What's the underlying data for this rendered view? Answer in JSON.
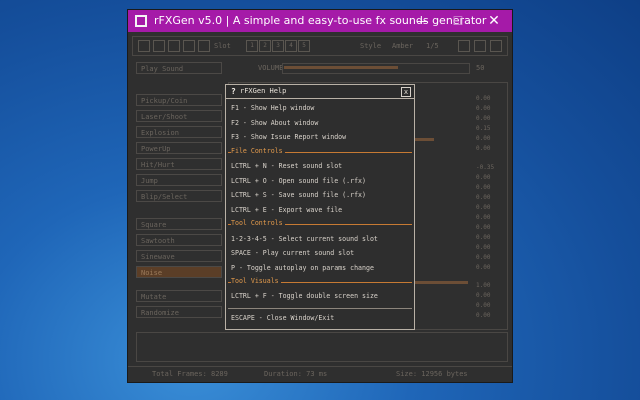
{
  "window": {
    "title": "rFXGen v5.0 | A simple and easy-to-use fx sounds generator",
    "min_glyph": "—",
    "max_glyph": "☐",
    "close_glyph": "✕"
  },
  "background_ui": {
    "toolbar_slots": [
      "1",
      "2",
      "3",
      "4",
      "5"
    ],
    "toolbar_slot_prefix": "Slot",
    "toolbar_style": "Style",
    "toolbar_amber": "Amber",
    "toolbar_scale": "1/5",
    "play_sound": "Play Sound",
    "volume_label": "VOLUME",
    "volume_value": "50",
    "generators": [
      "Pickup/Coin",
      "Laser/Shoot",
      "Explosion",
      "PowerUp",
      "Hit/Hurt",
      "Jump",
      "Blip/Select"
    ],
    "waveforms": [
      "Square",
      "Sawtooth",
      "Sinewave",
      "Noise"
    ],
    "mutate": "Mutate",
    "randomize": "Randomize",
    "values": [
      "0.00",
      "0.00",
      "0.00",
      "0.15",
      "0.00",
      "0.00",
      "-0.35",
      "0.00",
      "0.00",
      "0.00",
      "0.00",
      "0.00",
      "0.00",
      "0.00",
      "0.00",
      "0.00",
      "0.00",
      "0.00",
      "0.00",
      "1.00",
      "0.00",
      "0.00",
      "0.00"
    ],
    "status_frames": "Total Frames: 8289",
    "status_duration": "Duration: 73 ms",
    "status_size": "Size: 12956 bytes"
  },
  "help": {
    "title": "rFXGen Help",
    "close": "x",
    "lines_top": [
      "F1 - Show Help window",
      "F2 - Show About window",
      "F3 - Show Issue Report window"
    ],
    "file_controls": "File Controls",
    "file_lines": [
      "LCTRL + N - Reset sound slot",
      "LCTRL + O - Open sound file (.rfx)",
      "LCTRL + S - Save sound file (.rfx)",
      "LCTRL + E - Export wave file"
    ],
    "tool_controls": "Tool Controls",
    "tool_lines": [
      "1-2-3-4-5 - Select current sound slot",
      "SPACE - Play current sound slot",
      "P - Toggle autoplay on params change"
    ],
    "tool_visuals": "Tool Visuals",
    "visual_lines": [
      "LCTRL + F - Toggle double screen size"
    ],
    "escape_line": "ESCAPE - Close Window/Exit"
  },
  "colors": {
    "titlebar": "#a51aa8",
    "accent_orange": "#e29a4c",
    "desktop": "#1f66b8"
  }
}
